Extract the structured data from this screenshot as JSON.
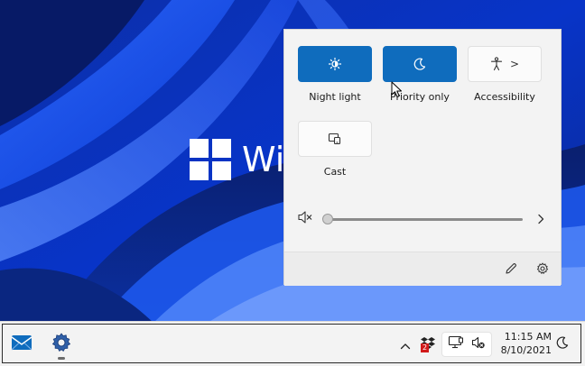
{
  "desktop": {
    "brand_text": "Wi"
  },
  "quick_settings": {
    "tiles": [
      {
        "label": "Night light",
        "state": "on",
        "icon": "brightness-icon"
      },
      {
        "label": "Priority only",
        "state": "on",
        "icon": "moon-icon"
      },
      {
        "label": "Accessibility",
        "state": "off",
        "icon": "accessibility-icon",
        "expand": ">"
      },
      {
        "label": "Cast",
        "state": "off",
        "icon": "cast-icon"
      }
    ],
    "volume": {
      "muted": true,
      "level": 0,
      "icon": "speaker-muted-icon",
      "more_icon": "chevron-right-icon"
    },
    "footer": {
      "edit_icon": "pencil-icon",
      "settings_icon": "gear-icon"
    }
  },
  "taskbar": {
    "pinned": [
      {
        "name": "mail-icon"
      },
      {
        "name": "settings-icon",
        "running": true
      }
    ],
    "tray": {
      "overflow_icon": "chevron-up-icon",
      "badge_count": "2",
      "icons": [
        "dropbox-icon",
        "network-icon",
        "speaker-muted-icon"
      ]
    },
    "clock": {
      "time": "11:15 AM",
      "date": "8/10/2021"
    },
    "focus_icon": "moon-icon"
  },
  "colors": {
    "accent": "#0f6cbd",
    "wallpaper_base": "#0a2a9a",
    "panel_bg": "#f3f3f3"
  }
}
